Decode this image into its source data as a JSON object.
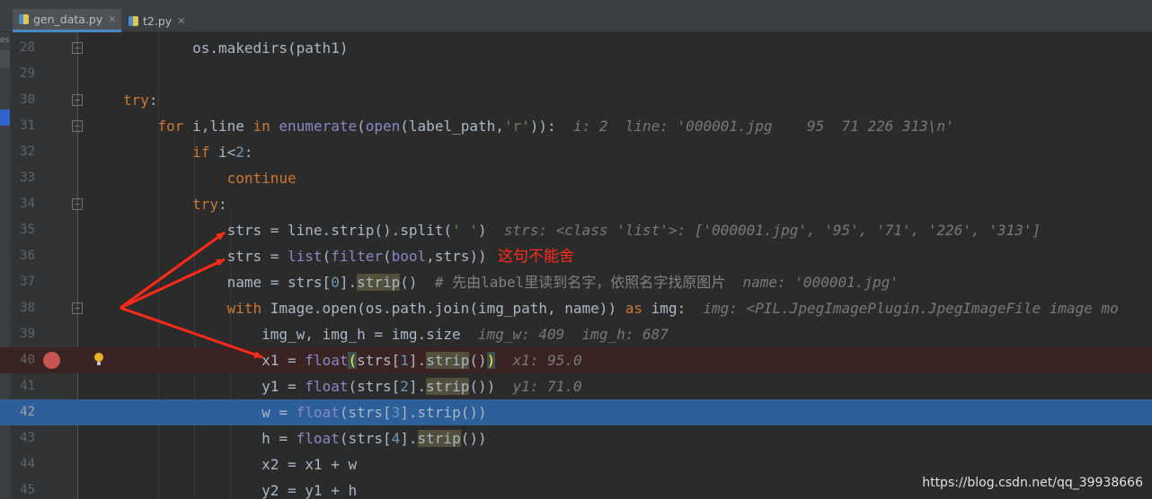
{
  "tabs": [
    {
      "label": "gen_data.py",
      "active": true
    },
    {
      "label": "t2.py",
      "active": false
    }
  ],
  "left_strip_label": "es",
  "lines": [
    {
      "num": "28"
    },
    {
      "num": "29"
    },
    {
      "num": "30"
    },
    {
      "num": "31"
    },
    {
      "num": "32"
    },
    {
      "num": "33"
    },
    {
      "num": "34"
    },
    {
      "num": "35"
    },
    {
      "num": "36"
    },
    {
      "num": "37"
    },
    {
      "num": "38"
    },
    {
      "num": "39"
    },
    {
      "num": "40"
    },
    {
      "num": "41"
    },
    {
      "num": "42"
    },
    {
      "num": "43"
    },
    {
      "num": "44"
    },
    {
      "num": "45"
    }
  ],
  "annotation": "这句不能舍",
  "watermark": "https://blog.csdn.net/qq_39938666",
  "colors": {
    "accent": "#2d5f9a",
    "breakpoint": "#c75450",
    "arrow": "#ff2a1a"
  }
}
